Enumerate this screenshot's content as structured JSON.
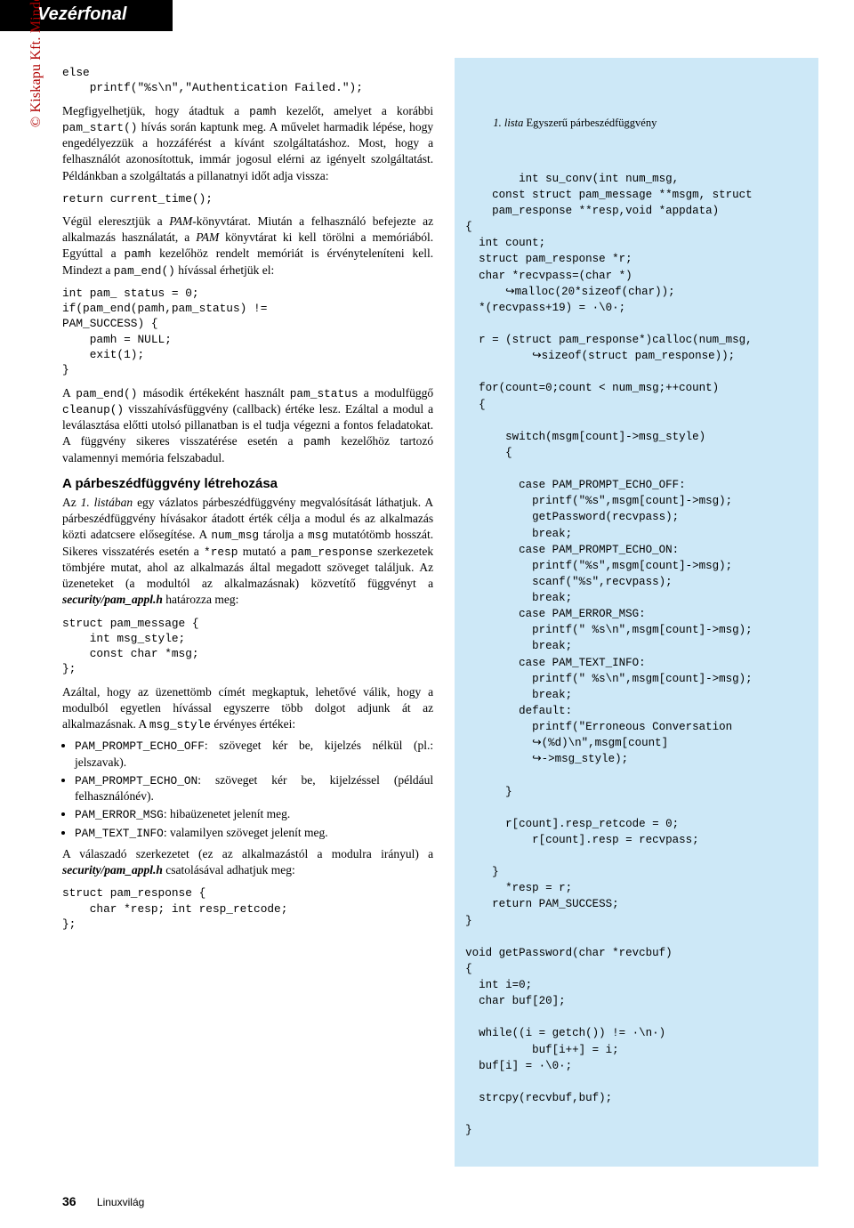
{
  "header": {
    "section": "Vezérfonal"
  },
  "sidebar": {
    "copyright": "© Kiskapu Kft. Minden jog fenntartva"
  },
  "left": {
    "code1": "else\n    printf(\"%s\\n\",\"Authentication Failed.\");",
    "p1a": "Megfigyelhetjük, hogy átadtuk a ",
    "p1_pamh": "pamh",
    "p1b": " kezelőt, amelyet a korábbi ",
    "p1_pamstart": "pam_start()",
    "p1c": " hívás során kaptunk meg. A művelet harmadik lépése, hogy engedélyezzük a hozzáférést a kívánt szolgáltatáshoz. Most, hogy a felhasználót azonosítottuk, immár jogosul elérni az igényelt szolgáltatást. Példánkban a szolgáltatás a pillanatnyi időt adja vissza:",
    "code2": "return current_time();",
    "p2a": "Végül eleresztjük a ",
    "p2_pam": "PAM",
    "p2b": "-könyvtárat. Miután a felhasználó befejezte az alkalmazás használatát, a ",
    "p2_pam2": "PAM",
    "p2c": " könyvtárat ki kell törölni a memóriából. Egyúttal a ",
    "p2_pamh": "pamh",
    "p2d": " kezelőhöz rendelt memóriát is érvényteleníteni kell. Mindezt a ",
    "p2_pamend": "pam_end()",
    "p2e": " hívással érhetjük el:",
    "code3": "int pam_ status = 0;\nif(pam_end(pamh,pam_status) !=\nPAM_SUCCESS) {\n    pamh = NULL;\n    exit(1);\n}",
    "p3a": "A ",
    "p3_pamend": "pam_end()",
    "p3b": " második értékeként használt ",
    "p3_pamstatus": "pam_status",
    "p3c": " a modulfüggő ",
    "p3_cleanup": "cleanup()",
    "p3d": " visszahívásfüggvény (callback) értéke lesz. Ezáltal a modul a leválasztása előtti utolsó pillanatban is el tudja végezni a fontos feladatokat. A függvény sikeres visszatérése esetén a ",
    "p3_pamh": "pamh",
    "p3e": " kezelőhöz tartozó valamennyi memória felszabadul.",
    "h3": "A párbeszédfüggvény létrehozása",
    "p4a": "Az ",
    "p4_lista": "1. listában",
    "p4b": " egy vázlatos párbeszédfüggvény megvalósítását láthatjuk. A párbeszédfüggvény hívásakor átadott érték célja a modul és az alkalmazás közti adatcsere elősegítése. A ",
    "p4_nummsg": "num_msg",
    "p4c": " tárolja a ",
    "p4_msg": "msg",
    "p4d": " mutatótömb hosszát. Sikeres visszatérés esetén a ",
    "p4_resp": "*resp",
    "p4e": " mutató a ",
    "p4_pamresp": "pam_response",
    "p4f": " szerkezetek tömbjére mutat, ahol az alkalmazás által megadott szöveget találjuk. Az üzeneteket (a modultól az alkalmazásnak) közvetítő függvényt a ",
    "p4_sec": "security/pam_appl.h",
    "p4g": " határozza meg:",
    "code4": "struct pam_message {\n    int msg_style;\n    const char *msg;\n};",
    "p5a": "Azáltal, hogy az üzenettömb címét megkaptuk, lehetővé válik, hogy a modulból egyetlen hívással egyszerre több dolgot adjunk át az alkalmazásnak. A ",
    "p5_msgstyle": "msg_style",
    "p5b": " érvényes értékei:",
    "bullets": [
      {
        "code": "PAM_PROMPT_ECHO_OFF",
        "text": ": szöveget kér be, kijelzés nélkül (pl.: jelszavak)."
      },
      {
        "code": "PAM_PROMPT_ECHO_ON",
        "text": ": szöveget kér be, kijelzéssel (például felhasználónév)."
      },
      {
        "code": "PAM_ERROR_MSG",
        "text": ": hibaüzenetet jelenít meg."
      },
      {
        "code": "PAM_TEXT_INFO",
        "text": ": valamilyen szöveget jelenít meg."
      }
    ],
    "p6a": "A válaszadó szerkezetet (ez az alkalmazástól a modulra irányul) a ",
    "p6_sec": "security/pam_appl.h",
    "p6b": " csatolásával adhatjuk meg:",
    "code5": "struct pam_response {\n    char *resp; int resp_retcode;\n};"
  },
  "right": {
    "listing_caption_num": "1. lista",
    "listing_caption_rest": " Egyszerű párbeszédfüggvény",
    "code": "int su_conv(int num_msg,\n    const struct pam_message **msgm, struct\n    pam_response **resp,void *appdata)\n{\n  int count;\n  struct pam_response *r;\n  char *recvpass=(char *)\n      ↪malloc(20*sizeof(char));\n  *(recvpass+19) = ·\\0·;\n\n  r = (struct pam_response*)calloc(num_msg,\n          ↪sizeof(struct pam_response));\n\n  for(count=0;count < num_msg;++count)\n  {\n\n      switch(msgm[count]->msg_style)\n      {\n\n        case PAM_PROMPT_ECHO_OFF:\n          printf(\"%s\",msgm[count]->msg);\n          getPassword(recvpass);\n          break;\n        case PAM_PROMPT_ECHO_ON:\n          printf(\"%s\",msgm[count]->msg);\n          scanf(\"%s\",recvpass);\n          break;\n        case PAM_ERROR_MSG:\n          printf(\" %s\\n\",msgm[count]->msg);\n          break;\n        case PAM_TEXT_INFO:\n          printf(\" %s\\n\",msgm[count]->msg);\n          break;\n        default:\n          printf(\"Erroneous Conversation\n          ↪(%d)\\n\",msgm[count]\n          ↪->msg_style);\n\n      }\n\n      r[count].resp_retcode = 0;\n          r[count].resp = recvpass;\n\n    }\n      *resp = r;\n    return PAM_SUCCESS;\n}\n\nvoid getPassword(char *revcbuf)\n{\n  int i=0;\n  char buf[20];\n\n  while((i = getch()) != ·\\n·)\n          buf[i++] = i;\n  buf[i] = ·\\0·;\n\n  strcpy(recvbuf,buf);\n\n}"
  },
  "footer": {
    "page": "36",
    "mag": "Linuxvilág"
  }
}
